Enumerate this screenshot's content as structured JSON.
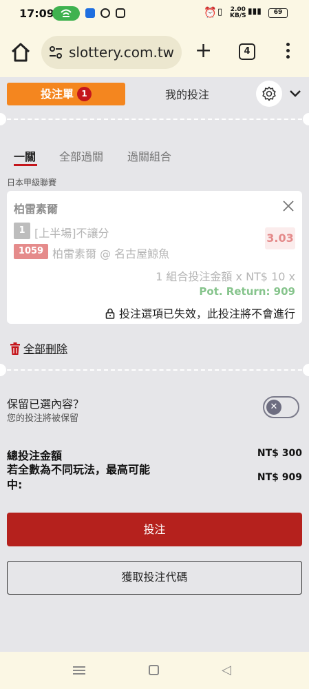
{
  "status_bar": {
    "time": "17:09",
    "net_speed_top": "2.00",
    "net_speed_unit": "KB/S",
    "signal": "⁴⁶ᴵᴵᴵ",
    "battery": "69"
  },
  "browser": {
    "url": "slottery.com.tw",
    "tab_count": "4"
  },
  "slip": {
    "tab_betslip": "投注單",
    "betslip_count": "1",
    "tab_mybets": "我的投注",
    "parlay_tabs": [
      "一關",
      "全部過關",
      "過關組合"
    ],
    "league": "日本甲級聯賽",
    "selection": {
      "team": "柏雷素爾",
      "market_number": "1",
      "market": "[上半場]不讓分",
      "match_number": "1059",
      "match": "柏雷素爾 @ 名古屋鯨魚",
      "odds": "3.03",
      "stake_line": "1 組合投注金額 x NT$ 10 x",
      "pot_return": "Pot. Return: 909",
      "invalid_message": "投注選項已失效，此投注將不會進行"
    },
    "delete_all": "全部刪除",
    "keep_title": "保留已選內容？",
    "keep_subtitle": "您的投注將被保留",
    "total_label": "總投注金額",
    "total_value": "NT$ 300",
    "maxwin_label": "若全數為不同玩法，最高可能中:",
    "maxwin_value": "NT$ 909",
    "place_bet": "投注",
    "get_code": "獲取投注代碼"
  },
  "colors": {
    "accent_orange": "#f4861f",
    "brand_red": "#b5211d",
    "badge_red": "#c4161c",
    "pot_return_green": "#86c48c"
  },
  "icons": {
    "home": "home-icon",
    "site_info": "site-settings-icon",
    "new_tab": "plus-icon",
    "tabs": "tab-switcher-icon",
    "menu": "more-vert-icon",
    "gear": "gear-icon",
    "collapse": "chevron-down-icon",
    "remove": "close-icon",
    "lock": "lock-icon",
    "trash": "trash-icon",
    "toggle_off": "x-icon"
  }
}
